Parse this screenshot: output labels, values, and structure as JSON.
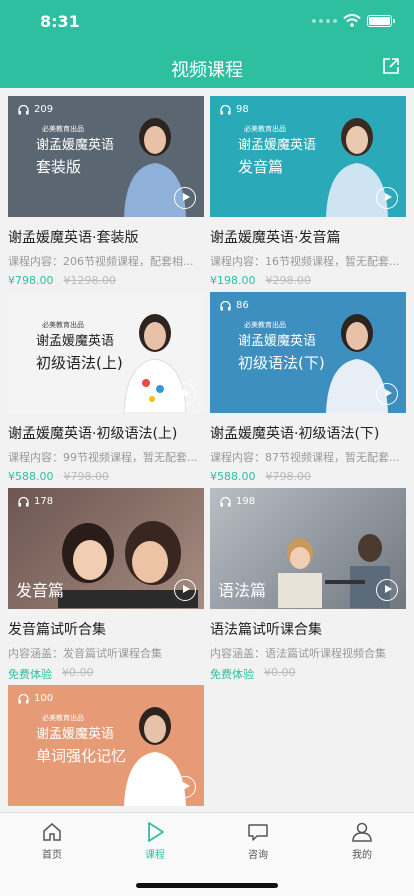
{
  "status": {
    "time": "8:31"
  },
  "header": {
    "title": "视频课程"
  },
  "courses": [
    {
      "plays": "209",
      "brand": "必美教育出品",
      "line1": "谢孟媛魔英语",
      "line2": "套装版",
      "tag": "",
      "title": "谢孟媛魔英语·套装版",
      "desc": "课程内容：206节视频课程，配套相...",
      "price": "¥798.00",
      "original": "¥1298.00",
      "bg": "#5b6673"
    },
    {
      "plays": "98",
      "brand": "必美教育出品",
      "line1": "谢孟媛魔英语",
      "line2": "发音篇",
      "tag": "",
      "title": "谢孟媛魔英语·发音篇",
      "desc": "课程内容：16节视频课程，暂无配套...",
      "price": "¥198.00",
      "original": "¥298.00",
      "bg": "#2aa9b8"
    },
    {
      "plays": "",
      "brand": "必美教育出品",
      "line1": "谢孟媛魔英语",
      "line2": "初级语法(上)",
      "tag": "",
      "title": "谢孟媛魔英语·初级语法(上)",
      "desc": "课程内容：99节视频课程，暂无配套...",
      "price": "¥588.00",
      "original": "¥798.00",
      "bg": "#f4f4f4"
    },
    {
      "plays": "86",
      "brand": "必美教育出品",
      "line1": "谢孟媛魔英语",
      "line2": "初级语法(下)",
      "tag": "",
      "title": "谢孟媛魔英语·初级语法(下)",
      "desc": "课程内容：87节视频课程，暂无配套...",
      "price": "¥588.00",
      "original": "¥798.00",
      "bg": "#3d8fbf"
    },
    {
      "plays": "178",
      "brand": "",
      "line1": "",
      "line2": "",
      "tag": "发音篇",
      "title": "发音篇试听合集",
      "desc": "内容涵盖：发音篇试听课程合集",
      "price": "免费体验",
      "original": "¥0.00",
      "bg": "#8a6f68"
    },
    {
      "plays": "198",
      "brand": "",
      "line1": "",
      "line2": "",
      "tag": "语法篇",
      "title": "语法篇试听课合集",
      "desc": "内容涵盖：语法篇试听课程视频合集",
      "price": "免费体验",
      "original": "¥0.00",
      "bg": "#8d96a0"
    },
    {
      "plays": "100",
      "brand": "必美教育出品",
      "line1": "谢孟媛魔英语",
      "line2": "单词强化记忆",
      "tag": "",
      "title": "",
      "desc": "",
      "price": "",
      "original": "",
      "bg": "#e69a76"
    }
  ],
  "tabbar": {
    "items": [
      {
        "label": "首页",
        "icon": "home-icon"
      },
      {
        "label": "课程",
        "icon": "play-icon",
        "active": true
      },
      {
        "label": "咨询",
        "icon": "chat-icon"
      },
      {
        "label": "我的",
        "icon": "user-icon"
      }
    ]
  },
  "colors": {
    "accent": "#2ebfa0"
  }
}
